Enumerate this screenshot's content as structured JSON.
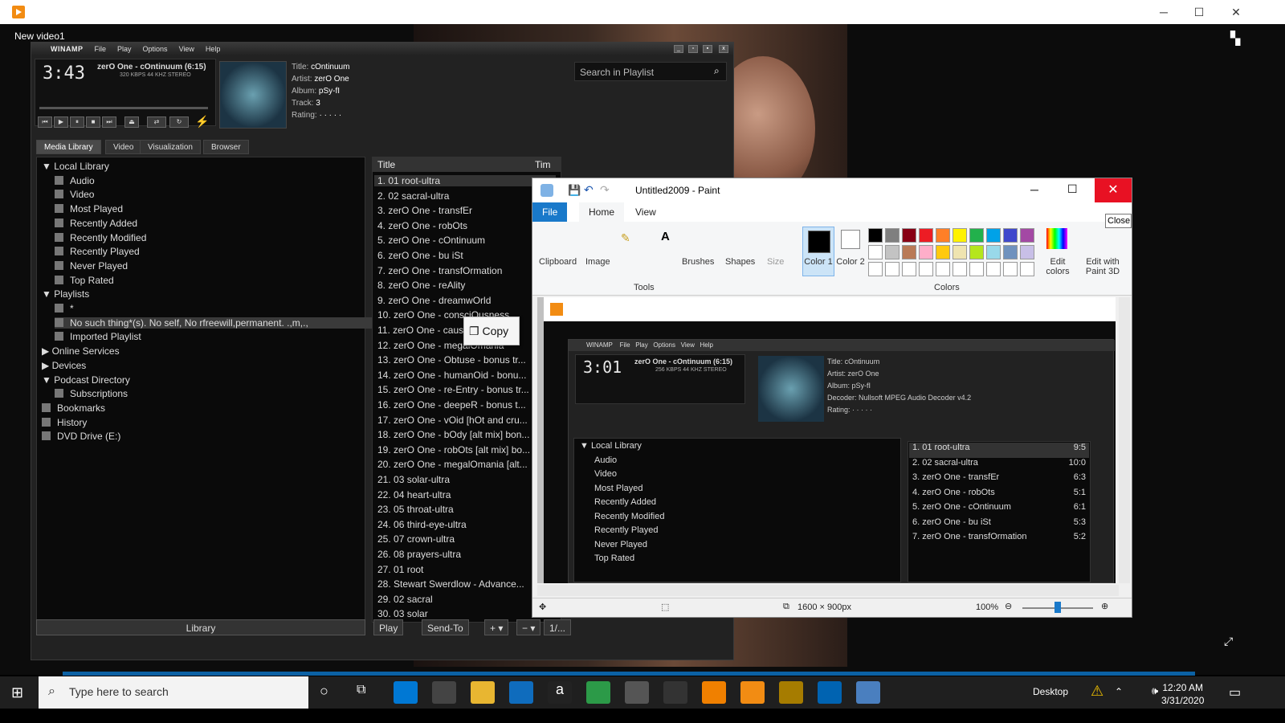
{
  "top_window": {
    "title": "New video1"
  },
  "winamp": {
    "brand": "WINAMP",
    "menu": [
      "File",
      "Play",
      "Options",
      "View",
      "Help"
    ],
    "time": "3:43",
    "track": "zerO One - cOntinuum (6:15)",
    "kbps": "320 KBPS 44 KHZ STEREO",
    "meta": {
      "title_label": "Title:",
      "title": "cOntinuum",
      "artist_label": "Artist:",
      "artist": "zerO One",
      "album_label": "Album:",
      "album": "pSy-fI",
      "track_label": "Track:",
      "track": "3",
      "rating_label": "Rating:",
      "rating": "· · · · ·"
    },
    "search_placeholder": "Search in Playlist",
    "tabs": [
      "Media Library",
      "Video",
      "Visualization",
      "Browser"
    ],
    "tree": [
      {
        "t": "▼ Local Library",
        "lvl": 0
      },
      {
        "t": "Audio",
        "lvl": 1
      },
      {
        "t": "Video",
        "lvl": 1
      },
      {
        "t": "Most Played",
        "lvl": 1
      },
      {
        "t": "Recently Added",
        "lvl": 1
      },
      {
        "t": "Recently Modified",
        "lvl": 1
      },
      {
        "t": "Recently Played",
        "lvl": 1
      },
      {
        "t": "Never Played",
        "lvl": 1
      },
      {
        "t": "Top Rated",
        "lvl": 1
      },
      {
        "t": "▼ Playlists",
        "lvl": 0
      },
      {
        "t": "*",
        "lvl": 1
      },
      {
        "t": "No such thing*(s). No self, No rfreewill,permanent. .,m,.,",
        "lvl": 1,
        "sel": true
      },
      {
        "t": "Imported Playlist",
        "lvl": 1
      },
      {
        "t": "▶ Online Services",
        "lvl": 0
      },
      {
        "t": "▶ Devices",
        "lvl": 0
      },
      {
        "t": "▼ Podcast Directory",
        "lvl": 0
      },
      {
        "t": "Subscriptions",
        "lvl": 1
      },
      {
        "t": "Bookmarks",
        "lvl": 0,
        "ic": true
      },
      {
        "t": "History",
        "lvl": 0,
        "ic": true
      },
      {
        "t": "DVD Drive (E:)",
        "lvl": 0,
        "ic": true
      }
    ],
    "playlist_header": "Title",
    "playlist_header_time": "Tim",
    "playlist": [
      "1. 01 root-ultra",
      "2. 02 sacral-ultra",
      "3. zerO One - transfEr",
      "4. zerO One - robOts",
      "5. zerO One - cOntinuum",
      "6. zerO One - bu iSt",
      "7. zerO One - transfOrmation",
      "8. zerO One - reAlity",
      "9. zerO One - dreamwOrld",
      "10. zerO One - consciOusness",
      "11. zerO One - causality",
      "12. zerO One - megalOmania",
      "13. zerO One - Obtuse - bonus tr...",
      "14. zerO One - humanOid - bonu...",
      "15. zerO One - re-Entry - bonus tr...",
      "16. zerO One - deepeR - bonus t...",
      "17. zerO One - vOid [hOt and cru...",
      "18. zerO One - bOdy [alt mix] bon...",
      "19. zerO One - robOts [alt mix] bo...",
      "20. zerO One - megalOmania [alt...",
      "21. 03 solar-ultra",
      "22. 04 heart-ultra",
      "23. 05 throat-ultra",
      "24. 06 third-eye-ultra",
      "25. 07 crown-ultra",
      "26. 08 prayers-ultra",
      "27. 01 root",
      "28. Stewart Swerdlow - Advance...",
      "29. 02 sacral",
      "30. 03 solar"
    ],
    "library_btn": "Library",
    "play_btn": "Play",
    "sendto_btn": "Send-To",
    "add_btn": "+ ▾",
    "rem_btn": "− ▾",
    "count": "1/..."
  },
  "copy_popup": "Copy",
  "paint": {
    "title": "Untitled2009 - Paint",
    "tabs": [
      "File",
      "Home",
      "View"
    ],
    "groups": {
      "clipboard": "Clipboard",
      "image": "Image",
      "tools": "Tools",
      "brushes": "Brushes",
      "shapes": "Shapes",
      "size": "Size",
      "color1": "Color 1",
      "color2": "Color 2",
      "colors": "Colors",
      "edit_colors": "Edit colors",
      "edit3d": "Edit with Paint 3D"
    },
    "tooltip": "Close",
    "dims": "1600 × 900px",
    "zoom": "100%",
    "palette": [
      "#000000",
      "#7f7f7f",
      "#880015",
      "#ed1c24",
      "#ff7f27",
      "#fff200",
      "#22b14c",
      "#00a2e8",
      "#3f48cc",
      "#a349a4",
      "#ffffff",
      "#c3c3c3",
      "#b97a57",
      "#ffaec9",
      "#ffc90e",
      "#efe4b0",
      "#b5e61d",
      "#99d9ea",
      "#7092be",
      "#c8bfe7"
    ]
  },
  "inner_winamp": {
    "time": "3:01",
    "track": "zerO One - cOntinuum (6:15)",
    "kbps": "256 KBPS 44 KHZ STEREO",
    "meta": [
      "Title: cOntinuum",
      "Artist: zerO One",
      "Album: pSy-fI",
      "Decoder: Nullsoft MPEG Audio Decoder v4.2",
      "Rating: · · · · ·"
    ],
    "tree": [
      "▼ Local Library",
      "Audio",
      "Video",
      "Most Played",
      "Recently Added",
      "Recently Modified",
      "Recently Played",
      "Never Played",
      "Top Rated"
    ],
    "playlist": [
      [
        "1. 01 root-ultra",
        "9:5"
      ],
      [
        "2. 02 sacral-ultra",
        "10:0"
      ],
      [
        "3. zerO One - transfEr",
        "6:3"
      ],
      [
        "4. zerO One - robOts",
        "5:1"
      ],
      [
        "5. zerO One - cOntinuum",
        "6:1"
      ],
      [
        "6. zerO One - bu iSt",
        "5:3"
      ],
      [
        "7. zerO One - transfOrmation",
        "5:2"
      ]
    ]
  },
  "taskbar": {
    "search_placeholder": "Type here to search",
    "desktop": "Desktop",
    "time": "12:20 AM",
    "date": "3/31/2020"
  }
}
